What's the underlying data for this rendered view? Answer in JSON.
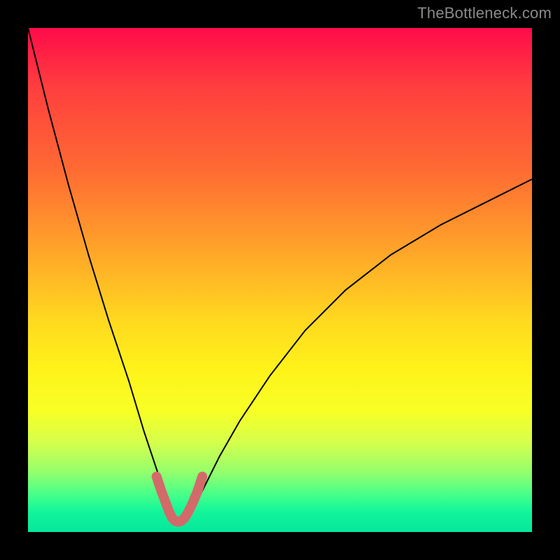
{
  "watermark": "TheBottleneck.com",
  "chart_data": {
    "type": "line",
    "title": "",
    "xlabel": "",
    "ylabel": "",
    "xlim": [
      0,
      100
    ],
    "ylim": [
      0,
      100
    ],
    "grid": false,
    "legend": false,
    "series": [
      {
        "name": "bottleneck-curve",
        "x": [
          0,
          4,
          8,
          12,
          16,
          20,
          23,
          25,
          27,
          28,
          29,
          30,
          31,
          32,
          33,
          35,
          38,
          42,
          48,
          55,
          63,
          72,
          82,
          92,
          100
        ],
        "y": [
          100,
          84,
          69,
          55,
          42,
          30,
          20,
          14,
          8,
          5,
          3,
          2,
          2,
          3,
          5,
          9,
          15,
          22,
          31,
          40,
          48,
          55,
          61,
          66,
          70
        ]
      },
      {
        "name": "trough-highlight",
        "x": [
          25.5,
          26.5,
          27.4,
          28.0,
          28.6,
          29.2,
          29.8,
          30.4,
          31.1,
          31.8,
          32.6,
          33.6,
          34.6
        ],
        "y": [
          11.0,
          8.0,
          5.6,
          4.0,
          2.8,
          2.2,
          2.0,
          2.2,
          2.8,
          4.0,
          5.6,
          8.0,
          11.0
        ]
      }
    ],
    "gradient_stops": [
      {
        "pos": 0,
        "color": "#ff0b4a"
      },
      {
        "pos": 12,
        "color": "#ff3f3e"
      },
      {
        "pos": 28,
        "color": "#ff6a33"
      },
      {
        "pos": 44,
        "color": "#ffa429"
      },
      {
        "pos": 58,
        "color": "#ffd91f"
      },
      {
        "pos": 68,
        "color": "#fff31a"
      },
      {
        "pos": 76,
        "color": "#f7ff25"
      },
      {
        "pos": 82,
        "color": "#d7ff4a"
      },
      {
        "pos": 88,
        "color": "#96ff6c"
      },
      {
        "pos": 93,
        "color": "#3fff8c"
      },
      {
        "pos": 96,
        "color": "#12f59a"
      },
      {
        "pos": 100,
        "color": "#06e79c"
      }
    ],
    "curve_style": {
      "color": "#000000",
      "width": 2
    },
    "highlight_style": {
      "color": "#d36a6a",
      "width": 14,
      "linecap": "round"
    }
  }
}
